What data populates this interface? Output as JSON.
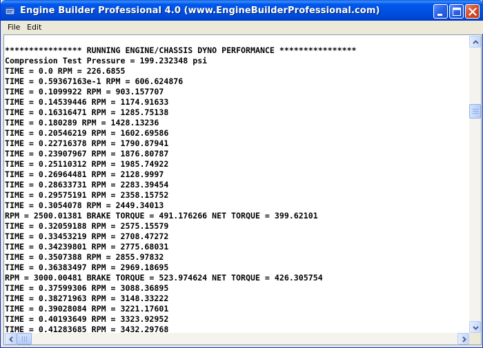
{
  "window": {
    "title": "Engine Builder Professional 4.0  (www.EngineBuilderProfessional.com)"
  },
  "menu": {
    "file": "File",
    "edit": "Edit"
  },
  "output_lines": [
    "**************** RUNNING ENGINE/CHASSIS DYNO PERFORMANCE ****************",
    "Compression Test Pressure = 199.232348 psi",
    "TIME = 0.0 RPM = 226.6855",
    "TIME = 0.59367163e-1 RPM = 606.624876",
    "TIME = 0.1099922 RPM = 903.157707",
    "TIME = 0.14539446 RPM = 1174.91633",
    "TIME = 0.16316471 RPM = 1285.75138",
    "TIME = 0.180289 RPM = 1428.13236",
    "TIME = 0.20546219 RPM = 1602.69586",
    "TIME = 0.22716378 RPM = 1790.87941",
    "TIME = 0.23907967 RPM = 1876.80787",
    "TIME = 0.25110312 RPM = 1985.74922",
    "TIME = 0.26964481 RPM = 2128.9997",
    "TIME = 0.28633731 RPM = 2283.39454",
    "TIME = 0.29575191 RPM = 2358.15752",
    "TIME = 0.3054078 RPM = 2449.34013",
    "RPM = 2500.01381 BRAKE TORQUE = 491.176266 NET TORQUE = 399.62101",
    "TIME = 0.32059188 RPM = 2575.15579",
    "TIME = 0.33453219 RPM = 2708.47272",
    "TIME = 0.34239801 RPM = 2775.68031",
    "TIME = 0.3507388 RPM = 2855.97832",
    "TIME = 0.36383497 RPM = 2969.18695",
    "RPM = 3000.00481 BRAKE TORQUE = 523.974624 NET TORQUE = 426.305754",
    "TIME = 0.37599306 RPM = 3088.36895",
    "TIME = 0.38271963 RPM = 3148.33222",
    "TIME = 0.39028084 RPM = 3221.17601",
    "TIME = 0.40193649 RPM = 3323.92952",
    "TIME = 0.41283685 RPM = 3432.29768"
  ],
  "icons": {
    "app": "engine-app-icon",
    "minimize": "minimize-icon",
    "maximize": "maximize-icon",
    "close": "close-icon"
  },
  "colors": {
    "titlebar": "#0054e3",
    "close_button": "#d64a24",
    "text": "#000000",
    "background": "#ffffff"
  }
}
